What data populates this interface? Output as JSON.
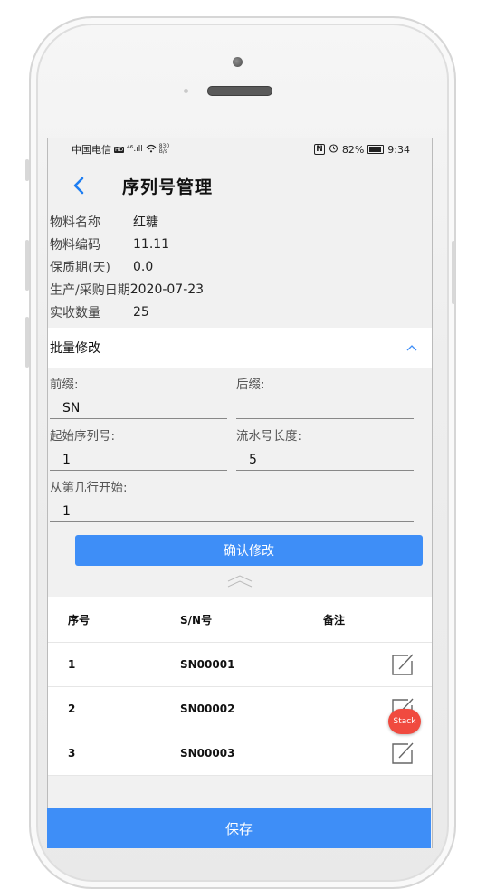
{
  "status_bar": {
    "carrier": "中国电信",
    "hd": "HD",
    "signal": "⁴⁶.ıll",
    "net_speed_value": "830",
    "net_speed_unit": "B/s",
    "nfc": "N",
    "battery_pct": "82%",
    "time": "9:34"
  },
  "header": {
    "title": "序列号管理"
  },
  "info": [
    {
      "label": "物料名称",
      "value": "红糖"
    },
    {
      "label": "物料编码",
      "value": "11.11"
    },
    {
      "label": "保质期(天)",
      "value": "0.0"
    },
    {
      "label": "生产/采购日期",
      "value": "2020-07-23"
    },
    {
      "label": "实收数量",
      "value": "25"
    }
  ],
  "batch": {
    "label": "批量修改"
  },
  "form": {
    "prefix_label": "前缀:",
    "prefix_value": "SN",
    "suffix_label": "后缀:",
    "suffix_value": "",
    "start_label": "起始序列号:",
    "start_value": "1",
    "length_label": "流水号长度:",
    "length_value": "5",
    "from_row_label": "从第几行开始:",
    "from_row_value": "1",
    "confirm_label": "确认修改"
  },
  "table": {
    "headers": [
      "序号",
      "S/N号",
      "备注"
    ],
    "rows": [
      {
        "no": "1",
        "sn": "SN00001"
      },
      {
        "no": "2",
        "sn": "SN00002"
      },
      {
        "no": "3",
        "sn": "SN00003"
      }
    ]
  },
  "stack_badge": "Stack",
  "save_label": "保存",
  "colors": {
    "accent": "#3e8ef7",
    "badge": "#f04a3f",
    "back_arrow": "#1e7ef2"
  },
  "icons": [
    "back-arrow-icon",
    "chevron-up-icon",
    "double-chevron-up-icon",
    "edit-icon"
  ]
}
